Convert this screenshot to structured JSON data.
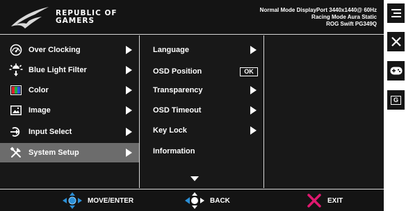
{
  "header": {
    "brand_line1": "REPUBLIC OF",
    "brand_line2": "GAMERS",
    "status_line1": "Normal Mode DisplayPort 3440x1440@ 60Hz",
    "status_line2": "Racing Mode Aura Static",
    "status_line3": "ROG Swift PG349Q"
  },
  "main_menu": {
    "items": [
      {
        "label": "Over Clocking",
        "icon": "speedometer-icon"
      },
      {
        "label": "Blue Light Filter",
        "icon": "sun-icon"
      },
      {
        "label": "Color",
        "icon": "color-palette-icon"
      },
      {
        "label": "Image",
        "icon": "image-icon"
      },
      {
        "label": "Input Select",
        "icon": "input-icon"
      },
      {
        "label": "System Setup",
        "icon": "tools-icon",
        "selected": true
      }
    ]
  },
  "submenu": {
    "items": [
      {
        "label": "Language",
        "control": "arrow"
      },
      {
        "label": "OSD Position",
        "control": "OK"
      },
      {
        "label": "Transparency",
        "control": "arrow"
      },
      {
        "label": "OSD Timeout",
        "control": "arrow"
      },
      {
        "label": "Key Lock",
        "control": "arrow"
      },
      {
        "label": "Information",
        "control": "none"
      }
    ],
    "ok_label": "OK"
  },
  "footer": {
    "move_label": "MOVE/ENTER",
    "back_label": "BACK",
    "exit_label": "EXIT"
  },
  "side_buttons": [
    "menu-icon",
    "close-icon",
    "gamepad-icon",
    "gameplus-icon"
  ],
  "side_g_label": "G",
  "colors": {
    "background": "#151515",
    "selected_row": "#6c6c6c",
    "joystick_blue": "#2b8fd6",
    "exit_pink": "#e0186f"
  }
}
